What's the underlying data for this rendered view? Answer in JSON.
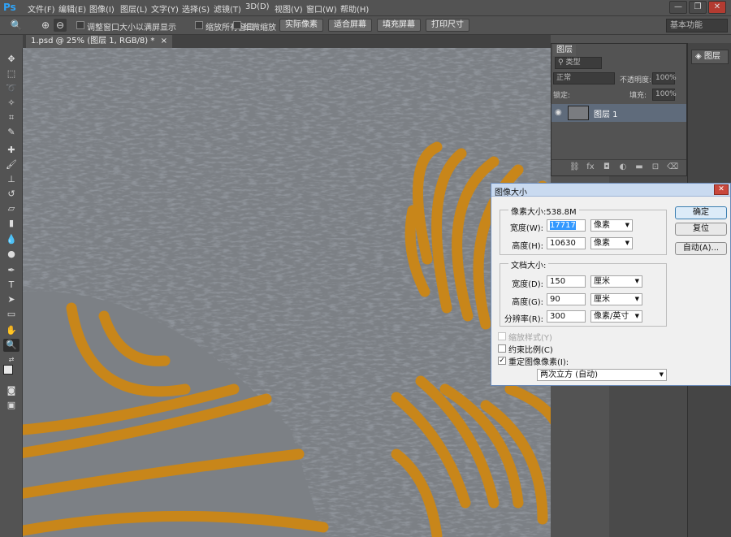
{
  "app": {
    "logo": "Ps"
  },
  "menu": [
    "文件(F)",
    "编辑(E)",
    "图像(I)",
    "图层(L)",
    "文字(Y)",
    "选择(S)",
    "滤镜(T)",
    "3D(D)",
    "视图(V)",
    "窗口(W)",
    "帮助(H)"
  ],
  "window_controls": {
    "minimize": "—",
    "restore": "❐",
    "close": "✕"
  },
  "options": {
    "checkbox_resize": "调整窗口大小以满屏显示",
    "checkbox_zoom_all": "缩放所有窗口",
    "checkbox_scrubby": "细微缩放",
    "btn_actual_pixels": "实际像素",
    "btn_fit_screen": "适合屏幕",
    "btn_fill_screen": "填充屏幕",
    "btn_print_size": "打印尺寸",
    "workspace": "基本功能"
  },
  "document": {
    "tab_label": "1.psd @ 25% (图层 1, RGB/8) *",
    "tab_close": "×"
  },
  "layers_panel": {
    "tab": "图层",
    "kind_label": "类型",
    "blend_mode": "正常",
    "opacity_label": "不透明度:",
    "opacity_value": "100%",
    "lock_label": "锁定:",
    "fill_label": "填充:",
    "fill_value": "100%",
    "layer_name": "图层 1"
  },
  "dock": {
    "layers_button": "图层"
  },
  "dialog": {
    "title": "图像大小",
    "pixel_dims_title": "像素大小:538.8M",
    "width_label": "宽度(W):",
    "width_value": "17717",
    "width_unit": "像素",
    "height_label": "高度(H):",
    "height_value": "10630",
    "height_unit": "像素",
    "doc_size_title": "文档大小:",
    "doc_width_label": "宽度(D):",
    "doc_width_value": "150",
    "doc_width_unit": "厘米",
    "doc_height_label": "高度(G):",
    "doc_height_value": "90",
    "doc_height_unit": "厘米",
    "resolution_label": "分辨率(R):",
    "resolution_value": "300",
    "resolution_unit": "像素/英寸",
    "scale_styles": "缩放样式(Y)",
    "constrain": "约束比例(C)",
    "resample": "重定图像像素(I):",
    "resample_method": "两次立方 (自动)",
    "ok": "确定",
    "reset": "复位",
    "auto": "自动(A)..."
  },
  "colors": {
    "accent_orange": "#c8861a",
    "canvas_gray": "#7c8085",
    "canvas_dark": "#454a51"
  }
}
